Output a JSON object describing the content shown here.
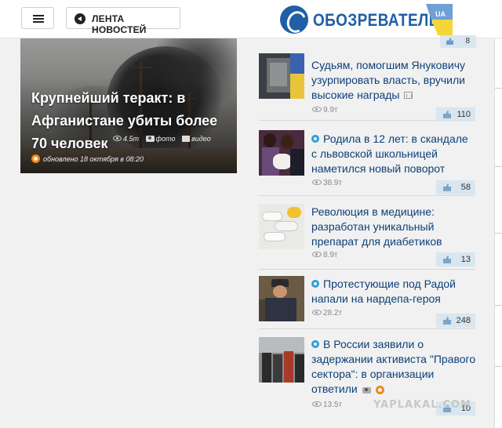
{
  "header": {
    "menu_icon": "hamburger-icon",
    "feed_label": "ЛЕНТА НОВОСТЕЙ",
    "feed_icon": "arrow-left-circle-icon",
    "logo_text": "ОБОЗРЕВАТЕЛЬ",
    "logo_badge": "UA"
  },
  "hero": {
    "title": "Крупнейший теракт: в Афганистане убиты более 70 человек",
    "views": "4.5т",
    "photo_label": "фото",
    "video_label": "видео",
    "updated": "обновлено 18 октября в 08:20"
  },
  "top_like_count": "8",
  "news": [
    {
      "title": "Судьям, помогшим Януковичу узурпировать власть, вручили высокие награды",
      "views": "9.9т",
      "likes": "110"
    },
    {
      "title": "Родила в 12 лет: в скандале с львовской школьницей наметился новый поворот",
      "views": "38.9т",
      "likes": "58"
    },
    {
      "title": "Революция в медицине: разработан уникальный препарат для диабетиков",
      "views": "8.9т",
      "likes": "13"
    },
    {
      "title": "Протестующие под Радой напали на нардепа-героя",
      "views": "28.2т",
      "likes": "248"
    },
    {
      "title": "В России заявили о задержании активиста \"Правого сектора\": в организации ответили",
      "views": "13.5т",
      "likes": "10"
    }
  ],
  "watermark": "YAPLAKAL.COM",
  "colors": {
    "link": "#0d3f79",
    "accent": "#1f5fa7",
    "like_bg": "#d9e6ef",
    "live": "#2c9fd8",
    "orange": "#f08a17"
  }
}
